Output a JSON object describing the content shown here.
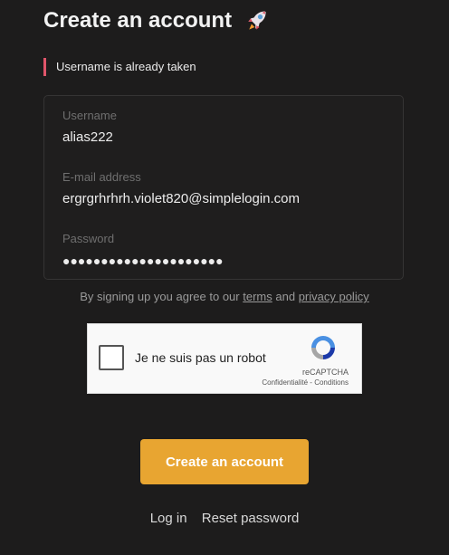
{
  "header": {
    "title": "Create an account",
    "icon": "rocket-icon"
  },
  "error": {
    "message": "Username is already taken",
    "color": "#e0556a"
  },
  "form": {
    "username": {
      "label": "Username",
      "value": "alias222"
    },
    "email": {
      "label": "E-mail address",
      "value": "ergrgrhrhrh.violet820@simplelogin.com"
    },
    "password": {
      "label": "Password",
      "value": "●●●●●●●●●●●●●●●●●●●●●"
    }
  },
  "terms": {
    "prefix": "By signing up you agree to our",
    "terms_link": "terms",
    "and": "and",
    "privacy_link": "privacy policy"
  },
  "captcha": {
    "label": "Je ne suis pas un robot",
    "brand": "reCAPTCHA",
    "privacy": "Confidentialité",
    "separator": "-",
    "conditions": "Conditions",
    "checked": false
  },
  "submit": {
    "label": "Create an account",
    "color": "#e8a531"
  },
  "footer": {
    "login": "Log in",
    "reset": "Reset password"
  }
}
